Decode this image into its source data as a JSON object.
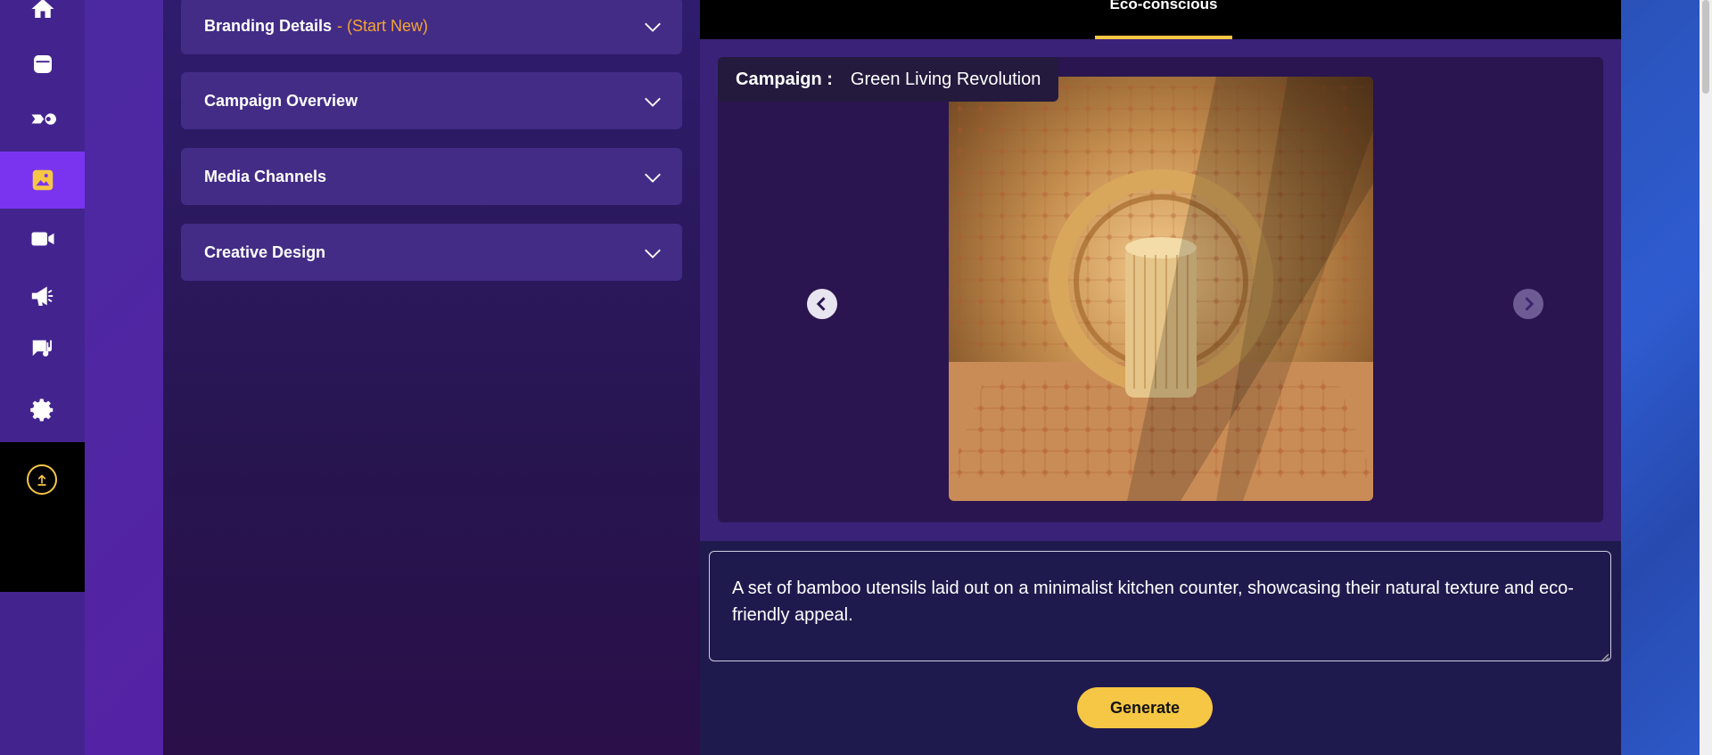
{
  "nav": {
    "items": [
      {
        "name": "home-icon"
      },
      {
        "name": "calendar-icon"
      },
      {
        "name": "workflow-icon"
      },
      {
        "name": "image-icon"
      },
      {
        "name": "video-icon"
      },
      {
        "name": "megaphone-icon"
      },
      {
        "name": "music-notes-icon"
      },
      {
        "name": "gear-icon"
      }
    ],
    "active": "image-icon",
    "upload": "upload-icon"
  },
  "left_panel": {
    "sections": [
      {
        "title": "Branding Details",
        "suffix": "- (Start New)"
      },
      {
        "title": "Campaign Overview",
        "suffix": ""
      },
      {
        "title": "Media Channels",
        "suffix": ""
      },
      {
        "title": "Creative Design",
        "suffix": ""
      }
    ]
  },
  "tabs": {
    "active_label": "Eco-conscious"
  },
  "preview": {
    "campaign_key": "Campaign :",
    "campaign_value": "Green Living Revolution",
    "image_alt": "Bamboo cylinder in front of a woven ring on patterned rug"
  },
  "prompt": {
    "value": "A set of bamboo utensils laid out on a minimalist kitchen counter, showcasing their natural texture and eco-friendly appeal."
  },
  "actions": {
    "generate_label": "Generate"
  },
  "colors": {
    "accent": "#f6c744",
    "orange": "#f5a534",
    "active_nav": "#7a34f0",
    "nav_bg": "#43248f"
  }
}
